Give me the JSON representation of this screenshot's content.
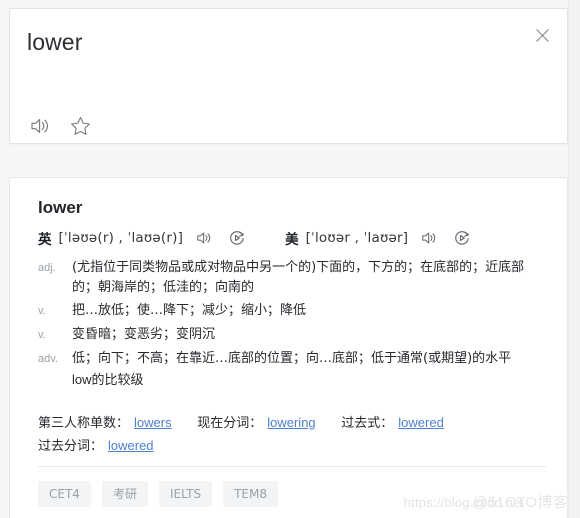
{
  "header": {
    "word": "lower",
    "close_icon": "close-icon",
    "actions": [
      {
        "name": "pronounce-button",
        "icon": "speaker-icon"
      },
      {
        "name": "favorite-button",
        "icon": "star-outline-icon"
      }
    ]
  },
  "entry": {
    "word": "lower",
    "phonetics": [
      {
        "locale": "英",
        "ipa": "[ˈləʊə(r) , ˈlaʊə(r)]",
        "speaker_icon": "speaker-icon",
        "play_icon": "play-loop-icon"
      },
      {
        "locale": "美",
        "ipa": "[ˈloʊər , ˈlaʊər]",
        "speaker_icon": "speaker-icon",
        "play_icon": "play-loop-icon"
      }
    ],
    "senses": [
      {
        "pos": "adj.",
        "definition": "(尤指位于同类物品或成对物品中另一个的)下面的，下方的；在底部的；近底部的；朝海岸的；低洼的；向南的"
      },
      {
        "pos": "v.",
        "definition": "把…放低；使…降下；减少；缩小；降低"
      },
      {
        "pos": "v.",
        "definition": "变昏暗；变恶劣；变阴沉"
      },
      {
        "pos": "adv.",
        "definition": "低；向下；不高；在靠近…底部的位置；向…底部；低于通常(或期望)的水平",
        "extra": "low的比较级"
      }
    ],
    "inflections": [
      [
        {
          "label": "第三人称单数：",
          "value": "lowers"
        },
        {
          "label": "现在分词：",
          "value": "lowering"
        },
        {
          "label": "过去式：",
          "value": "lowered"
        }
      ],
      [
        {
          "label": "过去分词：",
          "value": "lowered"
        }
      ]
    ],
    "tags": [
      "CET4",
      "考研",
      "IELTS",
      "TEM8"
    ]
  },
  "watermark": {
    "url": "https://blog.csdn.net",
    "brand": "@51CTO博客"
  },
  "colors": {
    "page_bg": "#f5f6f7",
    "card_bg": "#ffffff",
    "link": "#4d7fcf",
    "pos_label": "#9aa0a6",
    "tag_bg": "#f3f4f5",
    "tag_text": "#9ba1a7"
  }
}
